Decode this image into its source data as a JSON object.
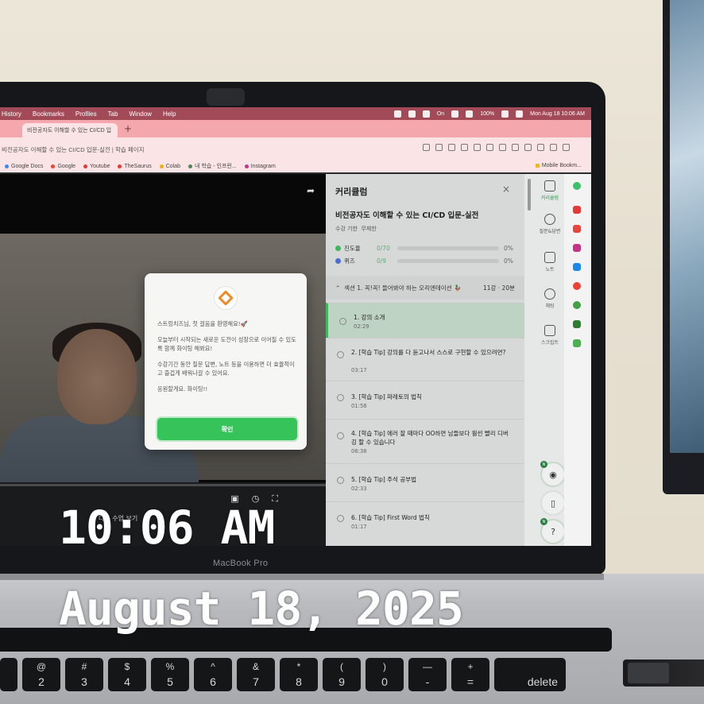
{
  "scene": {
    "laptop_label": "MacBook Pro"
  },
  "menubar": {
    "items": [
      "History",
      "Bookmarks",
      "Profiles",
      "Tab",
      "Window",
      "Help"
    ],
    "focus_status": "On",
    "battery": "100%",
    "datetime": "Mon Aug 18  10:06 AM"
  },
  "browser": {
    "tab_title": "비전공자도 이해할 수 있는 CI/CD 입",
    "url_text": "비전공자도 이해할 수 있는 CI/CD 입문-실전 | 학습 페이지",
    "bookmarks": [
      "Google Docs",
      "Google",
      "Youtube",
      "TheSaurus",
      "Colab",
      "내 학습 - 인프런...",
      "Instagram"
    ],
    "bookmark_colors": [
      "#4285f4",
      "#ea4335",
      "#e53935",
      "#e53935",
      "#f9ab00",
      "#3f8f4e",
      "#c13584"
    ],
    "bookmarks_folder": "Mobile Bookm..."
  },
  "modal": {
    "greeting": "스트링치즈님, 첫 걸음을 환영해요!🚀",
    "paragraph1": "오늘부터 시작되는 새로운 도전이 성장으로 이어질 수 있도록 함께 화이팅 해봐요!",
    "paragraph2": "수강기간 동안 질문 답변, 노트 등을 이용하면 더 효율적이고 즐겁게 배워나갈 수 있어요.",
    "paragraph3": "응원할게요. 화이팅!!",
    "confirm_label": "확인"
  },
  "player": {
    "next_label": "다음 수업 보기"
  },
  "curriculum": {
    "panel_title": "커리큘럼",
    "course_title": "비전공자도 이해할 수 있는 CI/CD 입문-실전",
    "deadline_label": "수강 기한",
    "deadline_value": "무제한",
    "stats": [
      {
        "label": "진도율",
        "value": "0/70",
        "percent": "0%",
        "fraction": 0
      },
      {
        "label": "퀴즈",
        "value": "0/9",
        "percent": "0%",
        "fraction": 0
      }
    ],
    "section": {
      "title": "섹션 1. 꼭!꼭! 들어봐야 하는 오리엔테이션 🦆",
      "meta": "11강 · 20분"
    },
    "lessons": [
      {
        "title": "1. 강의 소개",
        "duration": "02:29"
      },
      {
        "title": "2. [학습 Tip] 강의를 다 듣고나서 스스로 구현할 수 있으려면?",
        "duration": "03:17"
      },
      {
        "title": "3. [학습 Tip] 파레토의 법칙",
        "duration": "01:58"
      },
      {
        "title": "4. [학습 Tip] 에러 잘 때마다 OO하면 남들보다 훨씬 빨리 디버깅 할 수 있습니다",
        "duration": "06:38"
      },
      {
        "title": "5. [학습 Tip] 주석 공부법",
        "duration": "02:33"
      },
      {
        "title": "6. [학습 Tip] First Word 법칙",
        "duration": "01:17"
      }
    ]
  },
  "sidebar": {
    "items": [
      "커리큘럼",
      "질문&답변",
      "노트",
      "채팅",
      "스크립트"
    ],
    "badge": "N",
    "help": "?"
  },
  "overlay": {
    "time": "10:06 AM",
    "date": "August 18, 2025"
  },
  "keyboard": {
    "row1": [
      [
        "@",
        "2"
      ],
      [
        "#",
        "3"
      ],
      [
        "$",
        "4"
      ],
      [
        "%",
        "5"
      ],
      [
        "^",
        "6"
      ],
      [
        "&",
        "7"
      ],
      [
        "*",
        "8"
      ],
      [
        "(",
        "9"
      ],
      [
        ")",
        "0"
      ],
      [
        "—",
        "-"
      ],
      [
        "+",
        "="
      ]
    ],
    "delete_label": "delete"
  }
}
